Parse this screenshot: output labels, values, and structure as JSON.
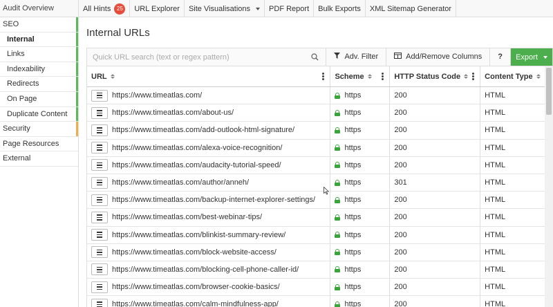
{
  "topbar": {
    "audit_overview": "Audit Overview",
    "tabs": [
      {
        "label": "All Hints",
        "badge": "25"
      },
      {
        "label": "URL Explorer"
      },
      {
        "label": "Site Visualisations",
        "dropdown": true
      },
      {
        "label": "PDF Report"
      },
      {
        "label": "Bulk Exports"
      },
      {
        "label": "XML Sitemap Generator"
      }
    ]
  },
  "sidebar": {
    "items": [
      {
        "label": "SEO",
        "sub": false
      },
      {
        "label": "Internal",
        "sub": true,
        "active": true
      },
      {
        "label": "Links",
        "sub": true
      },
      {
        "label": "Indexability",
        "sub": true
      },
      {
        "label": "Redirects",
        "sub": true
      },
      {
        "label": "On Page",
        "sub": true
      },
      {
        "label": "Duplicate Content",
        "sub": true
      },
      {
        "label": "Security",
        "sub": false
      },
      {
        "label": "Page Resources",
        "sub": false
      },
      {
        "label": "External",
        "sub": false
      }
    ],
    "colors": {
      "seo_stripe": "#5cb85c",
      "security_stripe": "#f0ad4e"
    }
  },
  "main": {
    "title": "Internal URLs",
    "search_placeholder": "Quick URL search (text or regex pattern)",
    "adv_filter": "Adv. Filter",
    "add_remove": "Add/Remove Columns",
    "help": "?",
    "export": "Export",
    "columns": [
      "URL",
      "Scheme",
      "HTTP Status Code",
      "Content Type"
    ],
    "rows": [
      {
        "url": "https://www.timeatlas.com/",
        "scheme": "https",
        "status": "200",
        "type": "HTML"
      },
      {
        "url": "https://www.timeatlas.com/about-us/",
        "scheme": "https",
        "status": "200",
        "type": "HTML"
      },
      {
        "url": "https://www.timeatlas.com/add-outlook-html-signature/",
        "scheme": "https",
        "status": "200",
        "type": "HTML"
      },
      {
        "url": "https://www.timeatlas.com/alexa-voice-recognition/",
        "scheme": "https",
        "status": "200",
        "type": "HTML"
      },
      {
        "url": "https://www.timeatlas.com/audacity-tutorial-speed/",
        "scheme": "https",
        "status": "200",
        "type": "HTML"
      },
      {
        "url": "https://www.timeatlas.com/author/anneh/",
        "scheme": "https",
        "status": "301",
        "type": "HTML"
      },
      {
        "url": "https://www.timeatlas.com/backup-internet-explorer-settings/",
        "scheme": "https",
        "status": "200",
        "type": "HTML"
      },
      {
        "url": "https://www.timeatlas.com/best-webinar-tips/",
        "scheme": "https",
        "status": "200",
        "type": "HTML"
      },
      {
        "url": "https://www.timeatlas.com/blinkist-summary-review/",
        "scheme": "https",
        "status": "200",
        "type": "HTML"
      },
      {
        "url": "https://www.timeatlas.com/block-website-access/",
        "scheme": "https",
        "status": "200",
        "type": "HTML"
      },
      {
        "url": "https://www.timeatlas.com/blocking-cell-phone-caller-id/",
        "scheme": "https",
        "status": "200",
        "type": "HTML"
      },
      {
        "url": "https://www.timeatlas.com/browser-cookie-basics/",
        "scheme": "https",
        "status": "200",
        "type": "HTML"
      },
      {
        "url": "https://www.timeatlas.com/calm-mindfulness-app/",
        "scheme": "https",
        "status": "200",
        "type": "HTML"
      }
    ]
  }
}
